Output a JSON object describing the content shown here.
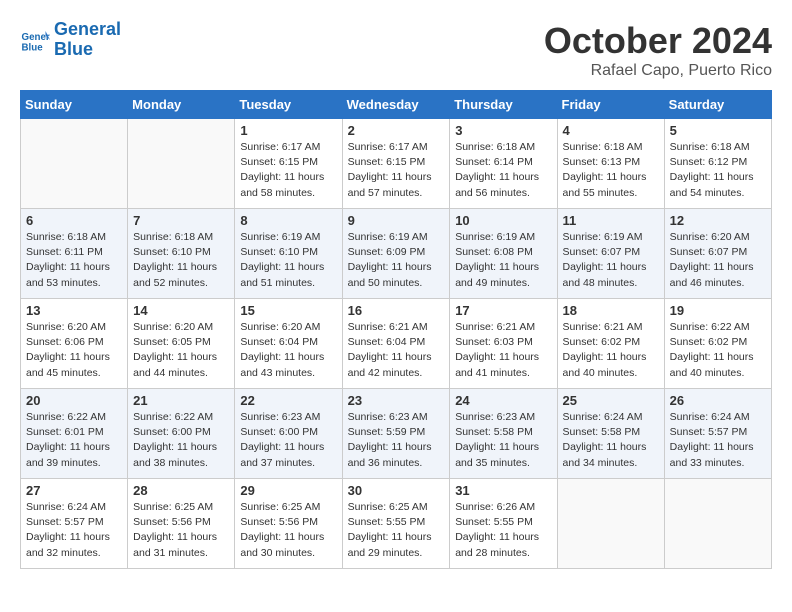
{
  "header": {
    "logo_line1": "General",
    "logo_line2": "Blue",
    "month_title": "October 2024",
    "location": "Rafael Capo, Puerto Rico"
  },
  "days_of_week": [
    "Sunday",
    "Monday",
    "Tuesday",
    "Wednesday",
    "Thursday",
    "Friday",
    "Saturday"
  ],
  "weeks": [
    [
      {
        "day": "",
        "sunrise": "",
        "sunset": "",
        "daylight": ""
      },
      {
        "day": "",
        "sunrise": "",
        "sunset": "",
        "daylight": ""
      },
      {
        "day": "1",
        "sunrise": "Sunrise: 6:17 AM",
        "sunset": "Sunset: 6:15 PM",
        "daylight": "Daylight: 11 hours and 58 minutes."
      },
      {
        "day": "2",
        "sunrise": "Sunrise: 6:17 AM",
        "sunset": "Sunset: 6:15 PM",
        "daylight": "Daylight: 11 hours and 57 minutes."
      },
      {
        "day": "3",
        "sunrise": "Sunrise: 6:18 AM",
        "sunset": "Sunset: 6:14 PM",
        "daylight": "Daylight: 11 hours and 56 minutes."
      },
      {
        "day": "4",
        "sunrise": "Sunrise: 6:18 AM",
        "sunset": "Sunset: 6:13 PM",
        "daylight": "Daylight: 11 hours and 55 minutes."
      },
      {
        "day": "5",
        "sunrise": "Sunrise: 6:18 AM",
        "sunset": "Sunset: 6:12 PM",
        "daylight": "Daylight: 11 hours and 54 minutes."
      }
    ],
    [
      {
        "day": "6",
        "sunrise": "Sunrise: 6:18 AM",
        "sunset": "Sunset: 6:11 PM",
        "daylight": "Daylight: 11 hours and 53 minutes."
      },
      {
        "day": "7",
        "sunrise": "Sunrise: 6:18 AM",
        "sunset": "Sunset: 6:10 PM",
        "daylight": "Daylight: 11 hours and 52 minutes."
      },
      {
        "day": "8",
        "sunrise": "Sunrise: 6:19 AM",
        "sunset": "Sunset: 6:10 PM",
        "daylight": "Daylight: 11 hours and 51 minutes."
      },
      {
        "day": "9",
        "sunrise": "Sunrise: 6:19 AM",
        "sunset": "Sunset: 6:09 PM",
        "daylight": "Daylight: 11 hours and 50 minutes."
      },
      {
        "day": "10",
        "sunrise": "Sunrise: 6:19 AM",
        "sunset": "Sunset: 6:08 PM",
        "daylight": "Daylight: 11 hours and 49 minutes."
      },
      {
        "day": "11",
        "sunrise": "Sunrise: 6:19 AM",
        "sunset": "Sunset: 6:07 PM",
        "daylight": "Daylight: 11 hours and 48 minutes."
      },
      {
        "day": "12",
        "sunrise": "Sunrise: 6:20 AM",
        "sunset": "Sunset: 6:07 PM",
        "daylight": "Daylight: 11 hours and 46 minutes."
      }
    ],
    [
      {
        "day": "13",
        "sunrise": "Sunrise: 6:20 AM",
        "sunset": "Sunset: 6:06 PM",
        "daylight": "Daylight: 11 hours and 45 minutes."
      },
      {
        "day": "14",
        "sunrise": "Sunrise: 6:20 AM",
        "sunset": "Sunset: 6:05 PM",
        "daylight": "Daylight: 11 hours and 44 minutes."
      },
      {
        "day": "15",
        "sunrise": "Sunrise: 6:20 AM",
        "sunset": "Sunset: 6:04 PM",
        "daylight": "Daylight: 11 hours and 43 minutes."
      },
      {
        "day": "16",
        "sunrise": "Sunrise: 6:21 AM",
        "sunset": "Sunset: 6:04 PM",
        "daylight": "Daylight: 11 hours and 42 minutes."
      },
      {
        "day": "17",
        "sunrise": "Sunrise: 6:21 AM",
        "sunset": "Sunset: 6:03 PM",
        "daylight": "Daylight: 11 hours and 41 minutes."
      },
      {
        "day": "18",
        "sunrise": "Sunrise: 6:21 AM",
        "sunset": "Sunset: 6:02 PM",
        "daylight": "Daylight: 11 hours and 40 minutes."
      },
      {
        "day": "19",
        "sunrise": "Sunrise: 6:22 AM",
        "sunset": "Sunset: 6:02 PM",
        "daylight": "Daylight: 11 hours and 40 minutes."
      }
    ],
    [
      {
        "day": "20",
        "sunrise": "Sunrise: 6:22 AM",
        "sunset": "Sunset: 6:01 PM",
        "daylight": "Daylight: 11 hours and 39 minutes."
      },
      {
        "day": "21",
        "sunrise": "Sunrise: 6:22 AM",
        "sunset": "Sunset: 6:00 PM",
        "daylight": "Daylight: 11 hours and 38 minutes."
      },
      {
        "day": "22",
        "sunrise": "Sunrise: 6:23 AM",
        "sunset": "Sunset: 6:00 PM",
        "daylight": "Daylight: 11 hours and 37 minutes."
      },
      {
        "day": "23",
        "sunrise": "Sunrise: 6:23 AM",
        "sunset": "Sunset: 5:59 PM",
        "daylight": "Daylight: 11 hours and 36 minutes."
      },
      {
        "day": "24",
        "sunrise": "Sunrise: 6:23 AM",
        "sunset": "Sunset: 5:58 PM",
        "daylight": "Daylight: 11 hours and 35 minutes."
      },
      {
        "day": "25",
        "sunrise": "Sunrise: 6:24 AM",
        "sunset": "Sunset: 5:58 PM",
        "daylight": "Daylight: 11 hours and 34 minutes."
      },
      {
        "day": "26",
        "sunrise": "Sunrise: 6:24 AM",
        "sunset": "Sunset: 5:57 PM",
        "daylight": "Daylight: 11 hours and 33 minutes."
      }
    ],
    [
      {
        "day": "27",
        "sunrise": "Sunrise: 6:24 AM",
        "sunset": "Sunset: 5:57 PM",
        "daylight": "Daylight: 11 hours and 32 minutes."
      },
      {
        "day": "28",
        "sunrise": "Sunrise: 6:25 AM",
        "sunset": "Sunset: 5:56 PM",
        "daylight": "Daylight: 11 hours and 31 minutes."
      },
      {
        "day": "29",
        "sunrise": "Sunrise: 6:25 AM",
        "sunset": "Sunset: 5:56 PM",
        "daylight": "Daylight: 11 hours and 30 minutes."
      },
      {
        "day": "30",
        "sunrise": "Sunrise: 6:25 AM",
        "sunset": "Sunset: 5:55 PM",
        "daylight": "Daylight: 11 hours and 29 minutes."
      },
      {
        "day": "31",
        "sunrise": "Sunrise: 6:26 AM",
        "sunset": "Sunset: 5:55 PM",
        "daylight": "Daylight: 11 hours and 28 minutes."
      },
      {
        "day": "",
        "sunrise": "",
        "sunset": "",
        "daylight": ""
      },
      {
        "day": "",
        "sunrise": "",
        "sunset": "",
        "daylight": ""
      }
    ]
  ]
}
